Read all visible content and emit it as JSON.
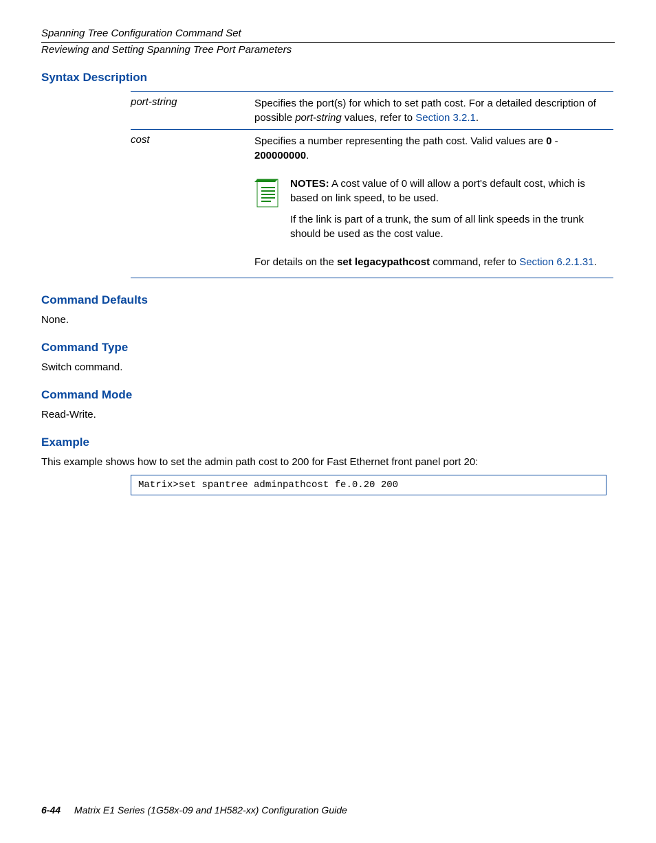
{
  "header": {
    "line1": "Spanning Tree Configuration Command Set",
    "line2": "Reviewing and Setting Spanning Tree Port Parameters"
  },
  "sections": {
    "syntax_desc": "Syntax Description",
    "command_defaults": "Command Defaults",
    "command_defaults_body": "None.",
    "command_type": "Command Type",
    "command_type_body": "Switch command.",
    "command_mode": "Command Mode",
    "command_mode_body": "Read-Write.",
    "example": "Example",
    "example_body": "This example shows how to set the admin path cost to 200 for Fast Ethernet front panel port 20:"
  },
  "syntax_rows": {
    "row1": {
      "col1": "port-string",
      "col2_pre": "Specifies the port(s) for which to set path cost. For a detailed description of possible ",
      "col2_ital": "port-string",
      "col2_post": " values, refer to ",
      "col2_link": "Section 3.2.1"
    },
    "row2": {
      "col1": "cost",
      "col2_a": "Specifies a number representing the path cost. Valid values are ",
      "col2_b1": "0",
      "col2_c": " - ",
      "col2_b2": "200000000",
      "col2_d": "."
    }
  },
  "notes": {
    "label": "NOTES:",
    "p1": "  A cost value of 0 will allow a port's default cost, which is based on link speed, to be used.",
    "p2": "If the link is part of a trunk, the sum of all link speeds in the trunk should be used as the cost value.",
    "p3a": "For details on the ",
    "p3b": "set legacypathcost",
    "p3c": " command, refer to ",
    "p3link": "Section 6.2.1.31",
    "p3d": "."
  },
  "example_code": "Matrix>set spantree adminpathcost fe.0.20 200",
  "footer": {
    "page": "6-44",
    "title": "Matrix E1 Series (1G58x-09 and 1H582-xx) Configuration Guide"
  }
}
